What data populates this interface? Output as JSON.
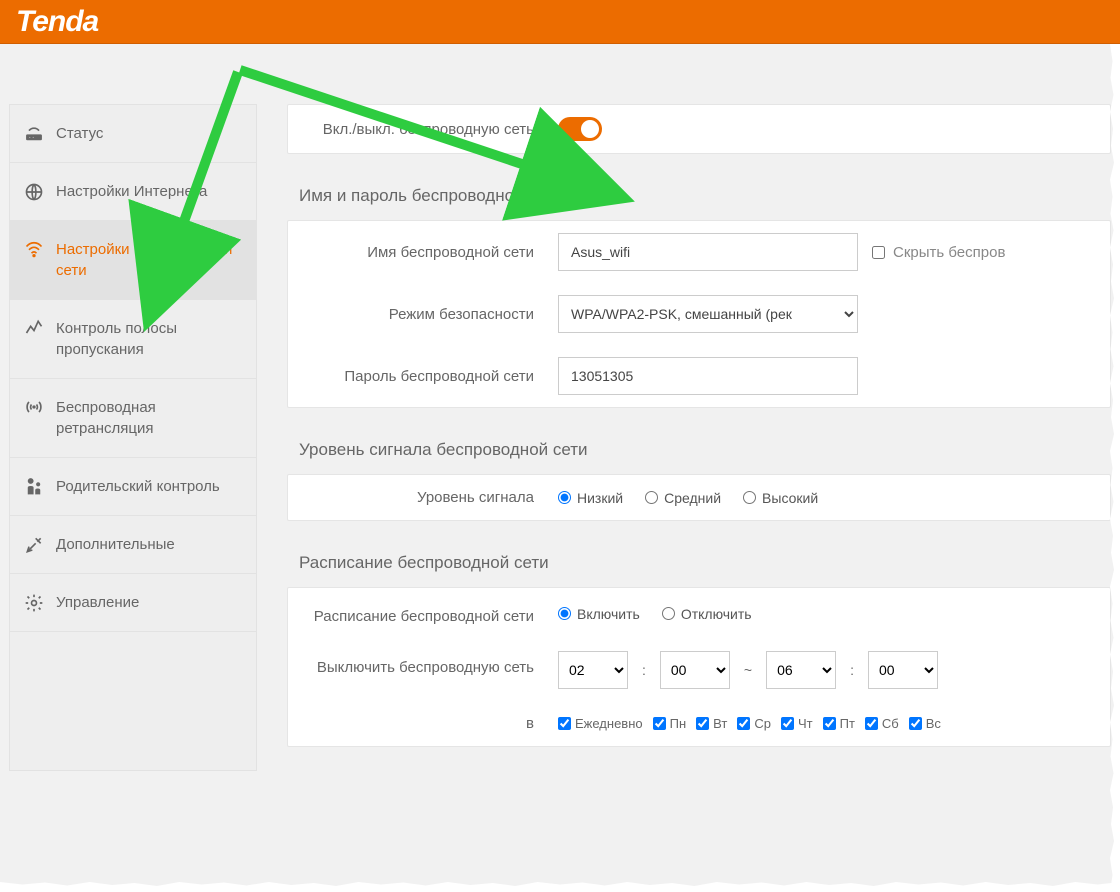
{
  "brand": "Tenda",
  "sidebar": {
    "items": [
      {
        "label": "Статус"
      },
      {
        "label": "Настройки Интернета"
      },
      {
        "label": "Настройки беспроводной сети"
      },
      {
        "label": "Контроль полосы пропускания"
      },
      {
        "label": "Беспроводная ретрансляция"
      },
      {
        "label": "Родительский контроль"
      },
      {
        "label": "Дополнительные"
      },
      {
        "label": "Управление"
      }
    ]
  },
  "wifi": {
    "toggle_label": "Вкл./выкл. беспроводную сеть",
    "name_section_title": "Имя и пароль беспроводной сети",
    "ssid_label": "Имя беспроводной сети",
    "ssid_value": "Asus_wifi",
    "hide_label": "Скрыть беспров",
    "security_label": "Режим безопасности",
    "security_value": "WPA/WPA2-PSK, смешанный (рек",
    "password_label": "Пароль беспроводной сети",
    "password_value": "13051305",
    "signal_section_title": "Уровень сигнала беспроводной сети",
    "signal_label": "Уровень сигнала",
    "signal_options": {
      "low": "Низкий",
      "mid": "Средний",
      "high": "Высокий"
    },
    "schedule_section_title": "Расписание беспроводной сети",
    "schedule_label": "Расписание беспроводной сети",
    "schedule_options": {
      "on": "Включить",
      "off": "Отключить"
    },
    "off_time_label": "Выключить беспроводную сеть",
    "time_from_h": "02",
    "time_from_m": "00",
    "time_to_h": "06",
    "time_to_m": "00",
    "days_label": "в",
    "days": [
      "Ежедневно",
      "Пн",
      "Вт",
      "Ср",
      "Чт",
      "Пт",
      "Сб",
      "Вс"
    ]
  }
}
